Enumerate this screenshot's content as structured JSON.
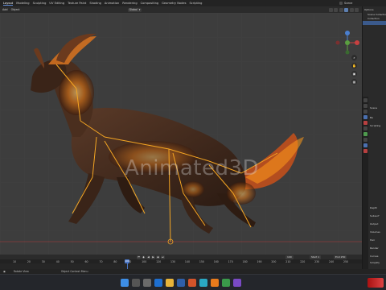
{
  "workspace_tabs": [
    "Layout",
    "Modeling",
    "Sculpting",
    "UV Editing",
    "Texture Paint",
    "Shading",
    "Animation",
    "Rendering",
    "Compositing",
    "Geometry Nodes",
    "Scripting"
  ],
  "active_tab_index": 0,
  "top_right": {
    "scene_label": "Scene"
  },
  "header": {
    "mode_add": "Add",
    "mode_object": "Object",
    "orientation": "Global",
    "options_label": "Options"
  },
  "viewport": {
    "watermark": "Animated3D",
    "gizmo_labels": {
      "y": "Y",
      "x": "X",
      "z": "Z"
    }
  },
  "outliner": {
    "rows": [
      "Scene Collection",
      "Collection",
      ""
    ]
  },
  "properties": {
    "labels": [
      "Scene",
      "Ba",
      "Scripting",
      "Depth",
      "Subsurf",
      "Output",
      "Volumes",
      "Hair",
      "Render",
      "Curves",
      "Simplify",
      "Motion",
      "Color M"
    ]
  },
  "timeline": {
    "start_label": "Start",
    "start_value": "1",
    "end_label": "End",
    "end_value": "250",
    "current_frame": "100",
    "ticks": [
      "10",
      "20",
      "30",
      "40",
      "50",
      "60",
      "70",
      "80",
      "90",
      "100",
      "120",
      "130",
      "140",
      "150",
      "160",
      "170",
      "180",
      "190",
      "200",
      "210",
      "220",
      "230",
      "240",
      "250"
    ],
    "lead_ticks": [
      "0",
      "10",
      "20"
    ]
  },
  "status_bar": {
    "left": "Rotate View",
    "middle": "Object Context Menu"
  },
  "colors": {
    "bone_color": "#f5a623",
    "fire_glow": "#ff9a1a",
    "accent": "#4b77c7"
  }
}
